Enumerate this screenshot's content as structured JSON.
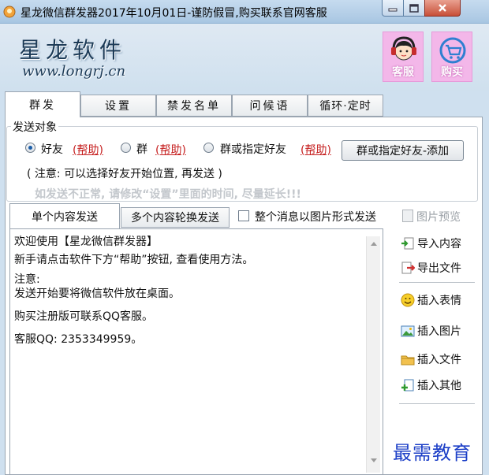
{
  "window": {
    "title": "星龙微信群发器2017年10月01日-谨防假冒,购买联系官网客服"
  },
  "header": {
    "brand_name": "星龙软件",
    "brand_url": "www.longrj.cn",
    "service_label": "客服",
    "buy_label": "购买"
  },
  "tabs": [
    {
      "label": "群发",
      "active": true
    },
    {
      "label": "设置",
      "active": false
    },
    {
      "label": "禁发名单",
      "active": false
    },
    {
      "label": "问候语",
      "active": false
    },
    {
      "label": "循环·定时",
      "active": false
    }
  ],
  "send_target": {
    "legend": "发送对象",
    "options": [
      {
        "label": "好友",
        "checked": true
      },
      {
        "label": "群",
        "checked": false
      },
      {
        "label": "群或指定好友",
        "checked": false
      }
    ],
    "help_label": "(帮助)",
    "add_button": "群或指定好友-添加",
    "note": "( 注意: 可以选择好友开始位置, 再发送 )",
    "warning": "如发送不正常, 请修改“设置”里面的时间, 尽量延长!!!"
  },
  "subtabs": [
    {
      "label": "单个内容发送",
      "active": true
    },
    {
      "label": "多个内容轮换发送",
      "active": false
    }
  ],
  "image_mode_label": "整个消息以图片形式发送",
  "image_mode_checked": false,
  "preview_label": "图片预览",
  "editor": {
    "lines": [
      "欢迎使用【星龙微信群发器】",
      "",
      "新手请点击软件下方“帮助”按钮, 查看使用方法。",
      "",
      "注意:",
      "发送开始要将微信软件放在桌面。",
      "",
      "购买注册版可联系QQ客服。",
      "",
      "客服QQ: 2353349959。"
    ]
  },
  "tools": {
    "import_label": "导入内容",
    "export_label": "导出文件",
    "emoji_label": "插入表情",
    "image_label": "插入图片",
    "file_label": "插入文件",
    "other_label": "插入其他"
  },
  "watermark": "最需教育"
}
